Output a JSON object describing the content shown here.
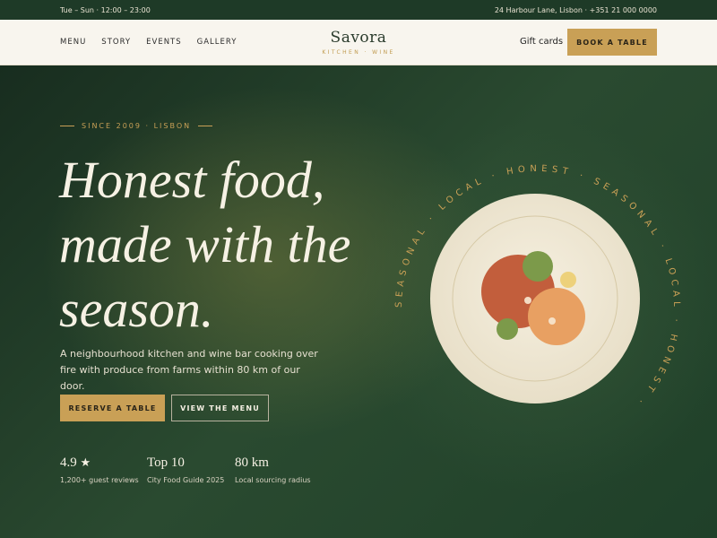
{
  "topbar": {
    "hours": "Tue – Sun · 12:00 – 23:00",
    "contact": "24 Harbour Lane, Lisbon · +351 21 000 0000"
  },
  "nav": {
    "links": [
      "MENU",
      "STORY",
      "EVENTS",
      "GALLERY"
    ],
    "brand_name": "Savora",
    "brand_tag": "KITCHEN · WINE",
    "gift_cards": "Gift cards",
    "book_button": "BOOK A TABLE"
  },
  "hero": {
    "eyebrow": "SINCE 2009 · LISBON",
    "headline": [
      "Honest food,",
      "made with the",
      "season."
    ],
    "description": "A neighbourhood kitchen and wine bar cooking over fire with produce from farms within 80 km of our door.",
    "primary_button": "RESERVE A TABLE",
    "secondary_button": "VIEW THE MENU",
    "stats": [
      {
        "value": "4.9",
        "icon": "star-icon",
        "label": "1,200+ guest reviews"
      },
      {
        "value": "Top 10",
        "label": "City Food Guide 2025"
      },
      {
        "value": "80 km",
        "label": "Local sourcing radius"
      }
    ],
    "ring_text": "SEASONAL · LOCAL · HONEST · SEASONAL · LOCAL · HONEST ·"
  },
  "colors": {
    "accent": "#c9a056",
    "dark_green": "#1e3a27",
    "cream": "#f8f5ee"
  }
}
